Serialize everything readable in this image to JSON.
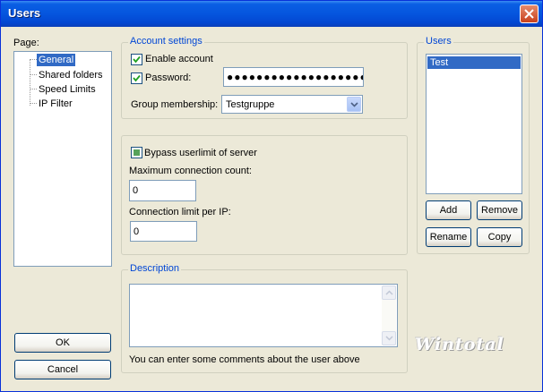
{
  "window": {
    "title": "Users"
  },
  "page_panel": {
    "label": "Page:",
    "items": [
      {
        "label": "General",
        "selected": true
      },
      {
        "label": "Shared folders",
        "selected": false
      },
      {
        "label": "Speed Limits",
        "selected": false
      },
      {
        "label": "IP Filter",
        "selected": false
      }
    ]
  },
  "account_settings": {
    "legend": "Account settings",
    "enable_account": {
      "label": "Enable account",
      "checked": true
    },
    "password": {
      "label": "Password:",
      "checked": true,
      "value": "●●●●●●●●●●●●●●●●●●●●●"
    },
    "group_membership": {
      "label": "Group membership:",
      "selected": "Testgruppe"
    }
  },
  "limits": {
    "bypass": {
      "label": "Bypass userlimit of server",
      "state": "indeterminate"
    },
    "max_connection": {
      "label": "Maximum connection count:",
      "value": "0"
    },
    "connection_per_ip": {
      "label": "Connection limit per IP:",
      "value": "0"
    }
  },
  "description": {
    "legend": "Description",
    "value": "",
    "hint": "You can enter some comments about the user above"
  },
  "users_panel": {
    "legend": "Users",
    "items": [
      "Test"
    ],
    "buttons": {
      "add": "Add",
      "remove": "Remove",
      "rename": "Rename",
      "copy": "Copy"
    }
  },
  "dialog_buttons": {
    "ok": "OK",
    "cancel": "Cancel"
  },
  "watermark": "Wintotal",
  "colors": {
    "titlebar": "#0555de",
    "selection": "#316ac5",
    "legend": "#0046d5",
    "face": "#ece9d8"
  }
}
